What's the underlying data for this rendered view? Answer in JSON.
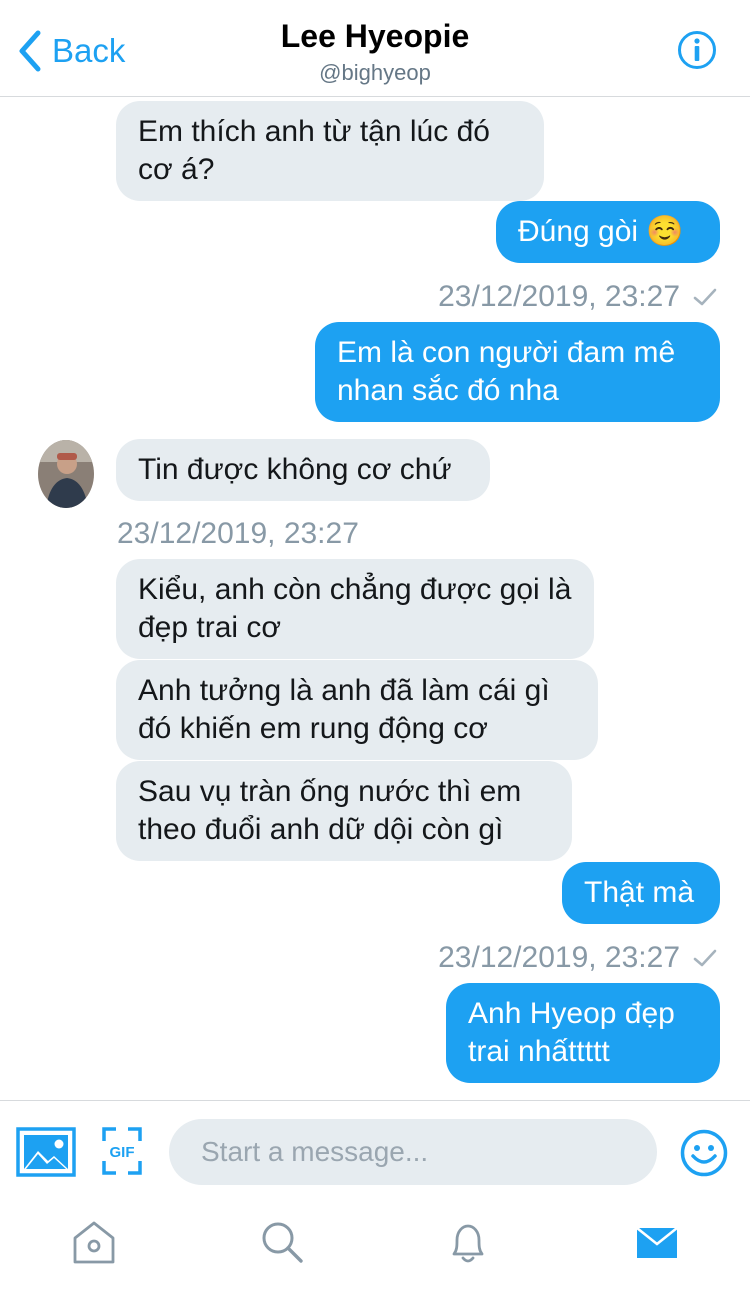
{
  "header": {
    "back_label": "Back",
    "title": "Lee Hyeopie",
    "handle": "@bighyeop",
    "info_icon": "info-icon"
  },
  "messages": [
    {
      "side": "in",
      "text": "Em thích anh từ tận lúc đó cơ á?"
    },
    {
      "side": "out",
      "text": "Đúng gòi ☺️"
    },
    {
      "side": "timestamp",
      "text": "23/12/2019, 23:27"
    },
    {
      "side": "out",
      "text": "Em là con người đam mê nhan sắc đó nha"
    },
    {
      "side": "in",
      "text": "Tin được không cơ chứ"
    },
    {
      "side": "timestamp",
      "text": "23/12/2019, 23:27"
    },
    {
      "side": "in",
      "text": "Kiểu, anh còn chẳng được gọi là đẹp trai cơ"
    },
    {
      "side": "in",
      "text": "Anh tưởng là anh đã làm cái gì đó khiến em rung động cơ"
    },
    {
      "side": "in",
      "text": "Sau vụ tràn ống nước thì em theo đuổi anh dữ dội còn gì"
    },
    {
      "side": "out",
      "text": "Thật mà"
    },
    {
      "side": "timestamp",
      "text": "23/12/2019, 23:27"
    },
    {
      "side": "out",
      "text": "Anh Hyeop đẹp trai nhấttttt"
    }
  ],
  "composer": {
    "placeholder": "Start a message...",
    "gif_label": "GIF"
  },
  "tabbar": {
    "items": [
      "home-icon",
      "search-icon",
      "notifications-icon",
      "messages-icon"
    ],
    "active": "messages-icon"
  },
  "colors": {
    "accent": "#1da1f2",
    "incoming_bubble": "#e6ecf0",
    "timestamp": "#8899a6"
  }
}
